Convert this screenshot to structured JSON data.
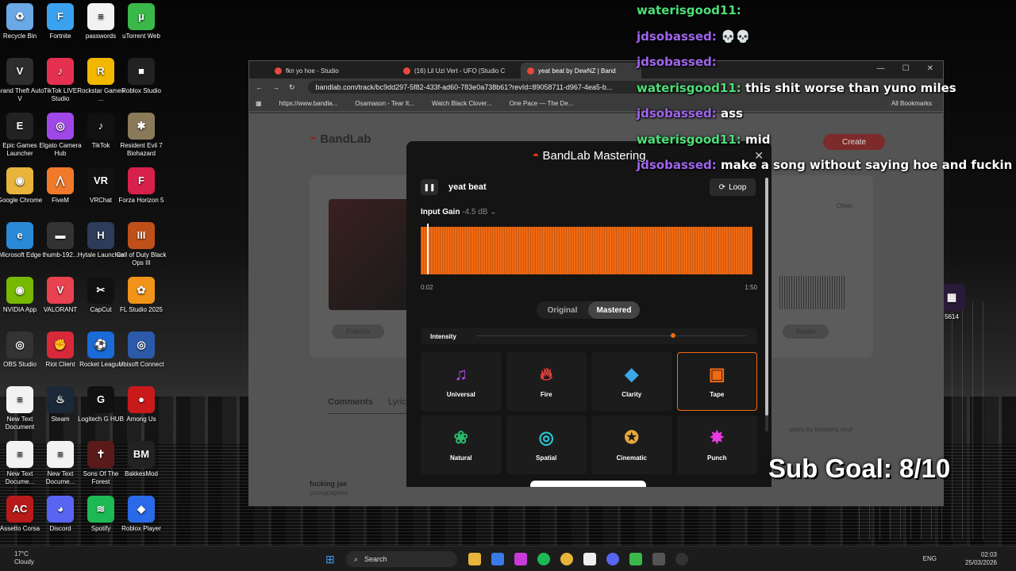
{
  "desktop": {
    "icons": [
      {
        "label": "Recycle Bin",
        "color": "#6aa8e6",
        "glyph": "♻"
      },
      {
        "label": "Fortnite",
        "color": "#3ba2f0",
        "glyph": "F"
      },
      {
        "label": "passwords",
        "color": "#f2f2f2",
        "glyph": "≡"
      },
      {
        "label": "uTorrent Web",
        "color": "#3bb84a",
        "glyph": "µ"
      },
      {
        "label": "Grand Theft Auto V",
        "color": "#2d2d2d",
        "glyph": "V"
      },
      {
        "label": "TikTok LIVE Studio",
        "color": "#e5314f",
        "glyph": "♪"
      },
      {
        "label": "Rockstar Games ...",
        "color": "#f2b800",
        "glyph": "R"
      },
      {
        "label": "Roblox Studio",
        "color": "#222222",
        "glyph": "■"
      },
      {
        "label": "Epic Games Launcher",
        "color": "#222222",
        "glyph": "E"
      },
      {
        "label": "Elgato Camera Hub",
        "color": "#a047e8",
        "glyph": "◎"
      },
      {
        "label": "TikTok",
        "color": "#111111",
        "glyph": "♪"
      },
      {
        "label": "Resident Evil 7 Biohazard",
        "color": "#8a7a5a",
        "glyph": "✱"
      },
      {
        "label": "Google Chrome",
        "color": "#e8b43a",
        "glyph": "◉"
      },
      {
        "label": "FiveM",
        "color": "#f07a2a",
        "glyph": "⋀"
      },
      {
        "label": "VRChat",
        "color": "#111111",
        "glyph": "VR"
      },
      {
        "label": "Forza Horizon 5",
        "color": "#d8204c",
        "glyph": "F"
      },
      {
        "label": "Microsoft Edge",
        "color": "#2b8ad8",
        "glyph": "e"
      },
      {
        "label": "thumb-192...",
        "color": "#333333",
        "glyph": "▬"
      },
      {
        "label": "Hytale Launcher",
        "color": "#2c3c5a",
        "glyph": "H"
      },
      {
        "label": "Call of Duty Black Ops III",
        "color": "#c0501a",
        "glyph": "III"
      },
      {
        "label": "NVIDIA App",
        "color": "#76b900",
        "glyph": "◉"
      },
      {
        "label": "VALORANT",
        "color": "#e8414f",
        "glyph": "V"
      },
      {
        "label": "CapCut",
        "color": "#111111",
        "glyph": "✂"
      },
      {
        "label": "FL Studio 2025",
        "color": "#f2931a",
        "glyph": "✿"
      },
      {
        "label": "OBS Studio",
        "color": "#333333",
        "glyph": "◎"
      },
      {
        "label": "Riot Client",
        "color": "#d8293a",
        "glyph": "✊"
      },
      {
        "label": "Rocket League",
        "color": "#1a6ad8",
        "glyph": "⚽"
      },
      {
        "label": "Ubisoft Connect",
        "color": "#2c5aa8",
        "glyph": "◎"
      },
      {
        "label": "New Text Document",
        "color": "#f2f2f2",
        "glyph": "≡"
      },
      {
        "label": "Steam",
        "color": "#1b2838",
        "glyph": "♨"
      },
      {
        "label": "Logitech G HUB",
        "color": "#111111",
        "glyph": "G"
      },
      {
        "label": "Among Us",
        "color": "#c81a1a",
        "glyph": "●"
      },
      {
        "label": "New Text Docume...",
        "color": "#f2f2f2",
        "glyph": "≡"
      },
      {
        "label": "New Text Docume...",
        "color": "#f2f2f2",
        "glyph": "≡"
      },
      {
        "label": "Sons Of The Forest",
        "color": "#5a1a1a",
        "glyph": "✝"
      },
      {
        "label": "BakkesMod",
        "color": "#222222",
        "glyph": "BM"
      },
      {
        "label": "Assetto Corsa",
        "color": "#b81a1a",
        "glyph": "AC"
      },
      {
        "label": "Discord",
        "color": "#5865f2",
        "glyph": "◕"
      },
      {
        "label": "Spotify",
        "color": "#1db954",
        "glyph": "≋"
      },
      {
        "label": "Roblox Player",
        "color": "#2a6ae8",
        "glyph": "◆"
      }
    ],
    "right_icon_label": "5614"
  },
  "browser": {
    "tabs": [
      {
        "label": "fkn yo hoe - Studio"
      },
      {
        "label": "(16) Lil Uzi Vert - UFO (Studio C"
      },
      {
        "label": "yeat beat by DewNZ | Band"
      }
    ],
    "url": "bandlab.com/track/bc9dd297-5f82-433f-ad60-783e0a738b61?revId=89058711-d967-4ea5-b...",
    "bookmarks": [
      "https://www.bandla...",
      "Osamason - Tear It...",
      "Watch Black Clover...",
      "One Pace — The De..."
    ],
    "all_bookmarks": "All Bookmarks",
    "page": {
      "logo": "BandLab",
      "create": "Create",
      "publish": "Publish",
      "studio": "Studio",
      "other": "Other",
      "comments_tab": "Comments",
      "lyrics_tab": "Lyric",
      "boost_text": "users by boosting your",
      "song_title": "fucking jae",
      "song_artist": "youngcapone"
    }
  },
  "mastering": {
    "title": "BandLab Mastering",
    "track_name": "yeat beat",
    "loop_label": "Loop",
    "input_gain_label": "Input Gain",
    "input_gain_value": "-4.5 dB",
    "time_start": "0:02",
    "time_end": "1:50",
    "toggle": {
      "original": "Original",
      "mastered": "Mastered",
      "selected": "Mastered"
    },
    "intensity_label": "Intensity",
    "intensity_value": 0.72,
    "presets": [
      {
        "label": "Universal",
        "icon": "music-note-icon",
        "glyph": "♫",
        "color": "#b44ee8",
        "selected": false
      },
      {
        "label": "Fire",
        "icon": "fire-icon",
        "glyph": "🔥︎",
        "color": "#e8413a",
        "selected": false
      },
      {
        "label": "Clarity",
        "icon": "diamond-icon",
        "glyph": "◆",
        "color": "#3aa8e8",
        "selected": false
      },
      {
        "label": "Tape",
        "icon": "cassette-icon",
        "glyph": "▣",
        "color": "#f26a12",
        "selected": true
      },
      {
        "label": "Natural",
        "icon": "lotus-icon",
        "glyph": "❀",
        "color": "#2ab86a",
        "selected": false
      },
      {
        "label": "Spatial",
        "icon": "spiral-icon",
        "glyph": "◎",
        "color": "#2ac8d8",
        "selected": false
      },
      {
        "label": "Cinematic",
        "icon": "film-reel-icon",
        "glyph": "✪",
        "color": "#e8a83a",
        "selected": false
      },
      {
        "label": "Punch",
        "icon": "burst-icon",
        "glyph": "✸",
        "color": "#e83ae0",
        "selected": false
      }
    ]
  },
  "chat": {
    "messages": [
      {
        "user": "waterisgood11:",
        "text": "",
        "color": "#4ee07a"
      },
      {
        "user": "jdsobassed:",
        "text": "💀💀",
        "color": "#a066ee"
      },
      {
        "user": "jdsobassed:",
        "text": "",
        "color": "#a066ee"
      },
      {
        "user": "waterisgood11:",
        "text": "this shit worse than yuno miles",
        "color": "#4ee07a"
      },
      {
        "user": "jdsobassed:",
        "text": "ass",
        "color": "#a066ee"
      },
      {
        "user": "waterisgood11:",
        "text": "mid",
        "color": "#4ee07a"
      },
      {
        "user": "jdsobassed:",
        "text": "make a song without saying hoe and fuckin the",
        "color": "#a066ee"
      }
    ]
  },
  "overlay": {
    "sub_goal": "Sub Goal: 8/10"
  },
  "taskbar": {
    "weather_temp": "17°C",
    "weather_desc": "Cloudy",
    "search_placeholder": "Search",
    "lang": "ENG",
    "time": "02:03",
    "date": "25/03/2026"
  }
}
